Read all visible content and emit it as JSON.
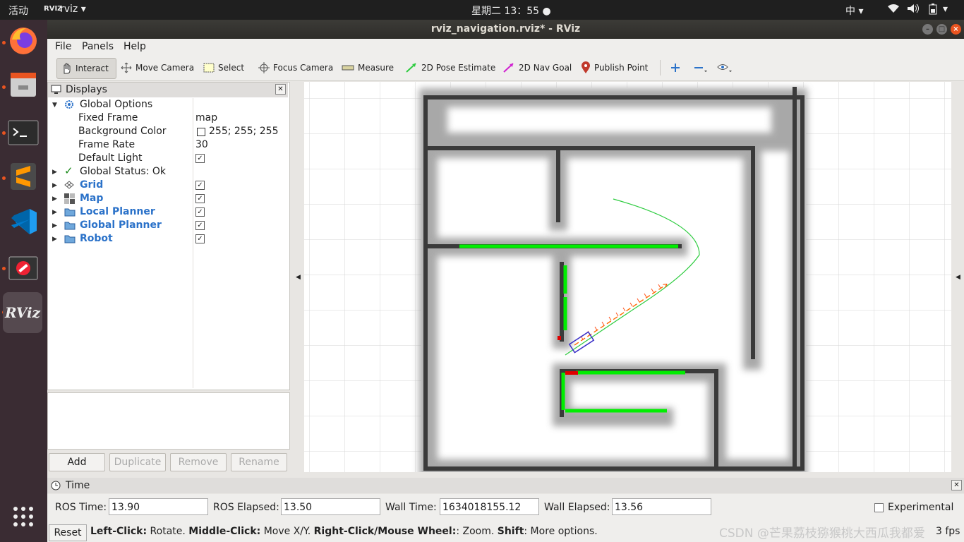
{
  "topbar": {
    "activities": "活动",
    "app": "rviz",
    "clock": "星期二 13：55",
    "ime": "中"
  },
  "window": {
    "title": "rviz_navigation.rviz* - RViz"
  },
  "menu": {
    "file": "File",
    "panels": "Panels",
    "help": "Help"
  },
  "toolbar": {
    "interact": "Interact",
    "move_camera": "Move Camera",
    "select": "Select",
    "focus_camera": "Focus Camera",
    "measure": "Measure",
    "pose_estimate": "2D Pose Estimate",
    "nav_goal": "2D Nav Goal",
    "publish_point": "Publish Point"
  },
  "displays": {
    "title": "Displays",
    "global_options": "Global Options",
    "fixed_frame_label": "Fixed Frame",
    "fixed_frame_value": "map",
    "bg_color_label": "Background Color",
    "bg_color_value": "255; 255; 255",
    "frame_rate_label": "Frame Rate",
    "frame_rate_value": "30",
    "default_light_label": "Default Light",
    "global_status": "Global Status: Ok",
    "items": [
      "Grid",
      "Map",
      "Local Planner",
      "Global Planner",
      "Robot"
    ]
  },
  "buttons": {
    "add": "Add",
    "duplicate": "Duplicate",
    "remove": "Remove",
    "rename": "Rename"
  },
  "time": {
    "title": "Time",
    "ros_time_label": "ROS Time:",
    "ros_time": "13.90",
    "ros_elapsed_label": "ROS Elapsed:",
    "ros_elapsed": "13.50",
    "wall_time_label": "Wall Time:",
    "wall_time": "1634018155.12",
    "wall_elapsed_label": "Wall Elapsed:",
    "wall_elapsed": "13.56",
    "experimental": "Experimental"
  },
  "status": {
    "reset": "Reset",
    "left": "Left-Click:",
    "left_t": " Rotate. ",
    "middle": "Middle-Click:",
    "middle_t": " Move X/Y. ",
    "right": "Right-Click/Mouse Wheel:",
    "right_t": ": Zoom. ",
    "shift": "Shift",
    "shift_t": ": More options.",
    "fps": "3 fps",
    "watermark": "CSDN @芒果荔枝猕猴桃大西瓜我都爱"
  },
  "colors": {
    "accent": "#2b72c9",
    "path": "#2ecc40",
    "obstacle": "#00ff00",
    "orange": "#e95420"
  }
}
